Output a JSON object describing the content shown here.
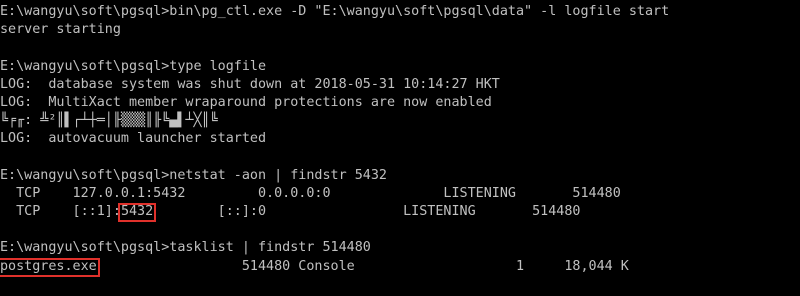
{
  "terminal": {
    "lines": [
      "E:\\wangyu\\soft\\pgsql>bin\\pg_ctl.exe -D \"E:\\wangyu\\soft\\pgsql\\data\" -l logfile start",
      "server starting",
      "",
      "E:\\wangyu\\soft\\pgsql>type logfile",
      "LOG:  database system was shut down at 2018-05-31 10:14:27 HKT",
      "LOG:  MultiXact member wraparound protections are now enabled",
      "╚╒╓: ╩²║▌┌┴┼═│╟▒▒▒║╟╚▄▌┴╳║╚",
      "LOG:  autovacuum launcher started",
      "",
      "E:\\wangyu\\soft\\pgsql>netstat -aon | findstr 5432",
      "  TCP    127.0.0.1:5432         0.0.0.0:0              LISTENING       514480",
      "  TCP    [::1]:",
      "5432",
      "        [::]:0                 LISTENING       514480",
      "",
      "E:\\wangyu\\soft\\pgsql>tasklist | findstr 514480",
      "postgres.exe",
      "                  514480 Console                    1     18,044 K"
    ]
  },
  "colors": {
    "background": "#000000",
    "text": "#c0c0c0",
    "highlight_box": "#e0312b"
  }
}
